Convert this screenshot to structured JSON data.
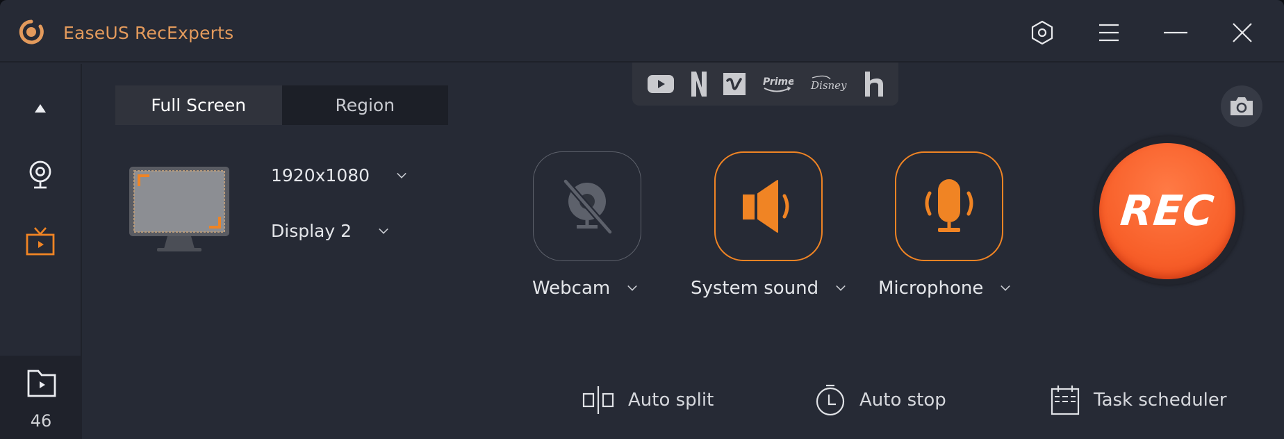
{
  "app": {
    "title": "EaseUS RecExperts",
    "accent_color": "#f08424",
    "rec_color": "#f8602a"
  },
  "titlebar": {
    "buttons": [
      {
        "name": "settings",
        "icon": "hexagon-settings-icon"
      },
      {
        "name": "menu",
        "icon": "hamburger-menu-icon"
      },
      {
        "name": "minimize",
        "icon": "minimize-icon"
      },
      {
        "name": "close",
        "icon": "close-icon"
      }
    ]
  },
  "sidebar": {
    "items": [
      {
        "name": "collapse",
        "icon": "triangle-up-icon",
        "active": false
      },
      {
        "name": "webcam-mode",
        "icon": "webcam-icon",
        "active": false
      },
      {
        "name": "video-mode",
        "icon": "tv-play-icon",
        "active": true
      }
    ],
    "recordings": {
      "icon": "folder-play-icon",
      "count": "46"
    }
  },
  "capture": {
    "tabs": [
      {
        "label": "Full Screen",
        "active": true
      },
      {
        "label": "Region",
        "active": false
      }
    ],
    "resolution": "1920x1080",
    "display": "Display 2"
  },
  "streaming_services": [
    "YouTube",
    "Netflix",
    "Vimeo",
    "Prime",
    "Disney",
    "Hulu"
  ],
  "streaming_labels": {
    "prime": "Prime",
    "disney": "Disney"
  },
  "sources": [
    {
      "label": "Webcam",
      "state": "off",
      "icon": "webcam-off-icon"
    },
    {
      "label": "System sound",
      "state": "on",
      "icon": "speaker-icon"
    },
    {
      "label": "Microphone",
      "state": "on",
      "icon": "microphone-icon"
    }
  ],
  "rec_button": {
    "label": "REC"
  },
  "screenshot_button": {
    "icon": "camera-icon"
  },
  "tools": [
    {
      "label": "Auto split",
      "icon": "split-icon"
    },
    {
      "label": "Auto stop",
      "icon": "timer-icon"
    },
    {
      "label": "Task scheduler",
      "icon": "calendar-icon"
    }
  ]
}
